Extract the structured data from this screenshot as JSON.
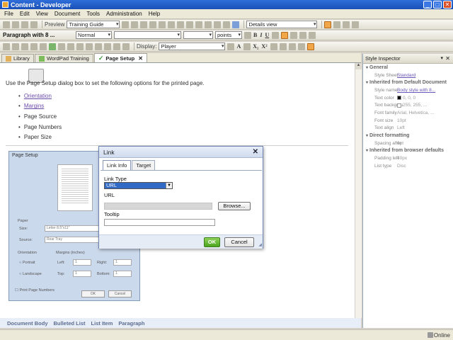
{
  "window": {
    "title": "Content - Developer"
  },
  "menu": [
    "File",
    "Edit",
    "View",
    "Document",
    "Tools",
    "Administration",
    "Help"
  ],
  "toolbar1": {
    "preview_label": "Preview",
    "preview_select": "Training Guide",
    "view_select": "Details view"
  },
  "toolbar2": {
    "paragraph_label": "Paragraph with 8 ...",
    "style_select": "Normal",
    "font_select": "",
    "size_select": "",
    "unit_select": "points"
  },
  "toolbar3": {
    "display_label": "Display:",
    "display_select": "Player"
  },
  "tabs": [
    {
      "label": "Library"
    },
    {
      "label": "WordPad Training"
    },
    {
      "label": "Page Setup"
    }
  ],
  "editor": {
    "intro": "Use the        Page Setup dialog box to set the following options for the printed page.",
    "items": [
      {
        "label": "Orientation"
      },
      {
        "label": "Margins"
      },
      {
        "label": "Page Source"
      },
      {
        "label": "Page Numbers"
      },
      {
        "label": "Paper Size"
      }
    ]
  },
  "pagesetup": {
    "title": "Page Setup",
    "paper_label": "Paper",
    "size_label": "Size:",
    "size_value": "Letter 8.5\"x11\"",
    "source_label": "Source:",
    "source_value": "Rear Tray",
    "orientation_label": "Orientation",
    "portrait_label": "Portrait",
    "landscape_label": "Landscape",
    "margins_label": "Margins (inches)",
    "left_label": "Left:",
    "left_value": "1",
    "right_label": "Right:",
    "right_value": "1",
    "top_label": "Top:",
    "top_value": "1",
    "bottom_label": "Bottom:",
    "bottom_value": "1",
    "print_page_numbers": "Print Page Numbers",
    "ok": "OK",
    "cancel": "Cancel"
  },
  "link_dialog": {
    "title": "Link",
    "tabs": [
      "Link Info",
      "Target"
    ],
    "link_type_label": "Link Type",
    "link_type_value": "URL",
    "url_label": "URL",
    "browse": "Browse...",
    "tooltip_label": "Tooltip",
    "ok": "OK",
    "cancel": "Cancel"
  },
  "stylebar": [
    "Document Body",
    "Bulleted List",
    "List Item",
    "Paragraph"
  ],
  "inspector": {
    "title": "Style Inspector",
    "sections": [
      {
        "name": "General",
        "rows": [
          {
            "k": "Style Sheet",
            "v": "Standard",
            "link": true
          }
        ]
      },
      {
        "name": "Inherited from Default Document",
        "rows": [
          {
            "k": "Style name",
            "v": "Body style with 8...",
            "link": true
          },
          {
            "k": "Text color",
            "v": "0, 0, 0"
          },
          {
            "k": "Text backgrou",
            "v": "255, 255, ..."
          },
          {
            "k": "Font family",
            "v": "Arial, Helvetica, ..."
          },
          {
            "k": "Font size",
            "v": "10pt"
          },
          {
            "k": "Text align",
            "v": "Left"
          }
        ]
      },
      {
        "name": "Direct formatting",
        "rows": [
          {
            "k": "Spacing after",
            "v": "6pt"
          }
        ]
      },
      {
        "name": "Inherited from browser defaults",
        "rows": [
          {
            "k": "Padding left",
            "v": "40px"
          },
          {
            "k": "List type",
            "v": "Disc"
          }
        ]
      }
    ]
  },
  "status": {
    "online": "Online"
  },
  "colors": {
    "titlebar": "#1a50b8",
    "link": "#6b4ca8",
    "ok_button": "#4aa51f",
    "accent": "#f1a649"
  }
}
